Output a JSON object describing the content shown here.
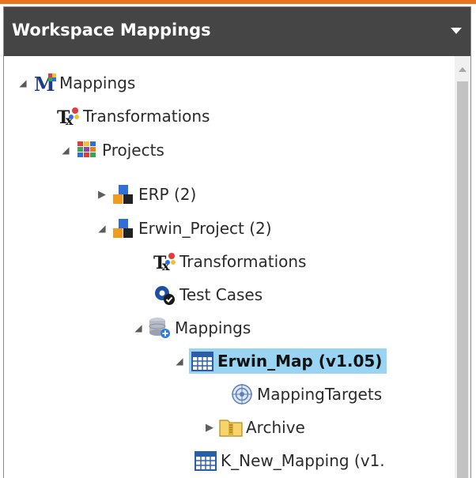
{
  "panel": {
    "title": "Workspace Mappings",
    "menu_icon": "chevron-down-icon"
  },
  "tree": {
    "root_mappings": {
      "label": "Mappings",
      "icon": "mappings-root-icon",
      "state": "expanded"
    },
    "transformations": {
      "label": "Transformations",
      "icon": "transformations-icon"
    },
    "projects": {
      "label": "Projects",
      "icon": "projects-icon",
      "state": "expanded"
    },
    "erp": {
      "label": "ERP (2)",
      "icon": "project-icon",
      "state": "collapsed"
    },
    "erwin_project": {
      "label": "Erwin_Project (2)",
      "icon": "project-icon",
      "state": "expanded"
    },
    "proj_transformations": {
      "label": "Transformations",
      "icon": "transformations-icon"
    },
    "test_cases": {
      "label": "Test Cases",
      "icon": "test-cases-icon"
    },
    "proj_mappings": {
      "label": "Mappings",
      "icon": "database-mappings-icon",
      "state": "expanded"
    },
    "erwin_map": {
      "label": "Erwin_Map (v1.05)",
      "icon": "map-calendar-icon",
      "state": "expanded",
      "selected": true
    },
    "mapping_targets": {
      "label": "MappingTargets",
      "icon": "target-icon"
    },
    "archive": {
      "label": "Archive",
      "icon": "archive-folder-icon",
      "state": "collapsed"
    },
    "k_new_mapping": {
      "label": "K_New_Mapping (v1.",
      "icon": "map-calendar-icon"
    }
  },
  "colors": {
    "accent_bar": "#e8741e",
    "header_bg": "#454545",
    "selection": "#99d4f2"
  }
}
